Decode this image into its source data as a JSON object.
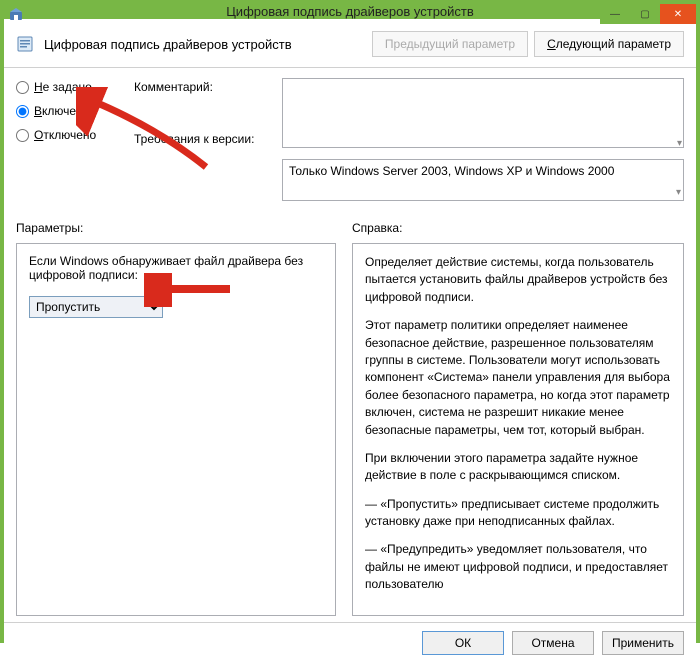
{
  "titlebar": {
    "title": "Цифровая подпись драйверов устройств"
  },
  "header": {
    "title": "Цифровая подпись драйверов устройств",
    "prev": "Предыдущий параметр",
    "next_prefix": "С",
    "next_rest": "ледующий параметр"
  },
  "radios": {
    "not_configured_prefix": "Н",
    "not_configured_rest": "е задано",
    "enabled_prefix": "В",
    "enabled_rest": "ключено",
    "disabled_prefix": "О",
    "disabled_rest": "тключено"
  },
  "labels": {
    "comment": "Комментарий:",
    "supported": "Требования к версии:",
    "options": "Параметры:",
    "help": "Справка:"
  },
  "fields": {
    "comment": "",
    "supported": "Только Windows Server 2003, Windows XP и Windows 2000"
  },
  "options": {
    "prompt": "Если Windows обнаруживает файл драйвера без цифровой подписи:",
    "selected": "Пропустить"
  },
  "help": {
    "p1": "Определяет действие системы, когда пользователь пытается установить файлы драйверов устройств без цифровой подписи.",
    "p2": "Этот параметр политики определяет наименее безопасное действие, разрешенное пользователям группы в системе. Пользователи могут использовать компонент «Система» панели управления для выбора более безопасного параметра, но когда этот параметр включен, система не разрешит никакие менее безопасные параметры, чем тот, который выбран.",
    "p3": "При включении этого параметра задайте нужное действие в поле с раскрывающимся списком.",
    "p4": "— «Пропустить» предписывает системе продолжить установку даже при неподписанных файлах.",
    "p5": "— «Предупредить» уведомляет пользователя, что файлы не имеют цифровой подписи, и предоставляет пользователю"
  },
  "footer": {
    "ok": "ОК",
    "cancel": "Отмена",
    "apply": "Применить"
  }
}
